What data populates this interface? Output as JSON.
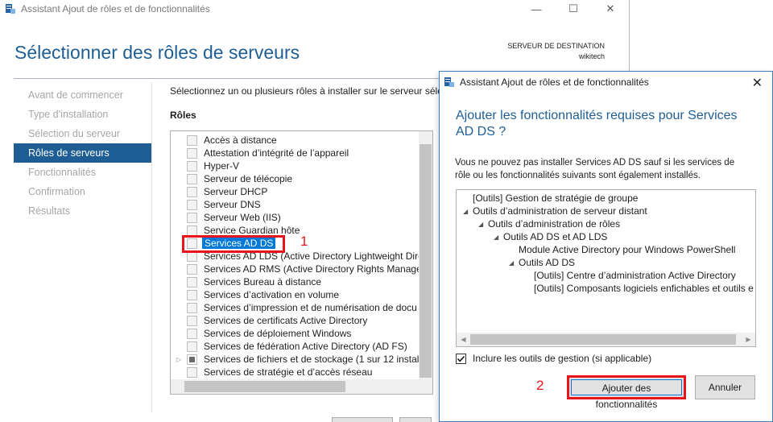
{
  "main": {
    "window_title": "Assistant Ajout de rôles et de fonctionnalités",
    "page_title": "Sélectionner des rôles de serveurs",
    "destination_label": "SERVEUR DE DESTINATION",
    "destination_server": "wikitech",
    "instruction": "Sélectionnez un ou plusieurs rôles à installer sur le serveur sélec",
    "roles_heading": "Rôles",
    "nav": [
      "Avant de commencer",
      "Type d’installation",
      "Sélection du serveur",
      "Rôles de serveurs",
      "Fonctionnalités",
      "Confirmation",
      "Résultats"
    ],
    "active_nav": "Rôles de serveurs",
    "roles": [
      "Accès à distance",
      "Attestation d’intégrité de l’appareil",
      "Hyper-V",
      "Serveur de télécopie",
      "Serveur DHCP",
      "Serveur DNS",
      "Serveur Web (IIS)",
      "Service Guardian hôte",
      "Services AD DS",
      "Services AD LDS (Active Directory Lightweight Dire",
      "Services AD RMS (Active Directory Rights Manager",
      "Services Bureau à distance",
      "Services d’activation en volume",
      "Services d’impression et de numérisation de docu",
      "Services de certificats Active Directory",
      "Services de déploiement Windows",
      "Services de fédération Active Directory (AD FS)",
      "Services de fichiers et de stockage (1 sur 12 installé",
      "Services de stratégie et d’accès réseau"
    ],
    "selected_role": "Services AD DS",
    "step1": "1"
  },
  "dialog": {
    "title": "Assistant Ajout de rôles et de fonctionnalités",
    "heading": "Ajouter les fonctionnalités requises pour Services AD DS ?",
    "text": "Vous ne pouvez pas installer Services AD DS sauf si les services de rôle ou les fonctionnalités suivants sont également installés.",
    "features": [
      "[Outils] Gestion de stratégie de groupe",
      "Outils d’administration de serveur distant",
      "Outils d’administration de rôles",
      "Outils AD DS et AD LDS",
      "Module Active Directory pour Windows PowerShell",
      "Outils AD DS",
      "[Outils] Centre d’administration Active Directory",
      "[Outils] Composants logiciels enfichables et outils e"
    ],
    "include_tools_label": "Inclure les outils de gestion (si applicable)",
    "include_tools_checked": true,
    "add_button": "Ajouter des fonctionnalités",
    "cancel_button": "Annuler",
    "step2": "2"
  },
  "icons": {
    "window_icon": "server-manager-icon",
    "minimize": "minimize-icon",
    "maximize": "maximize-icon",
    "close": "close-icon"
  },
  "colors": {
    "accent": "#1e5e95",
    "selection": "#0078d7",
    "highlight": "#e8141c"
  }
}
